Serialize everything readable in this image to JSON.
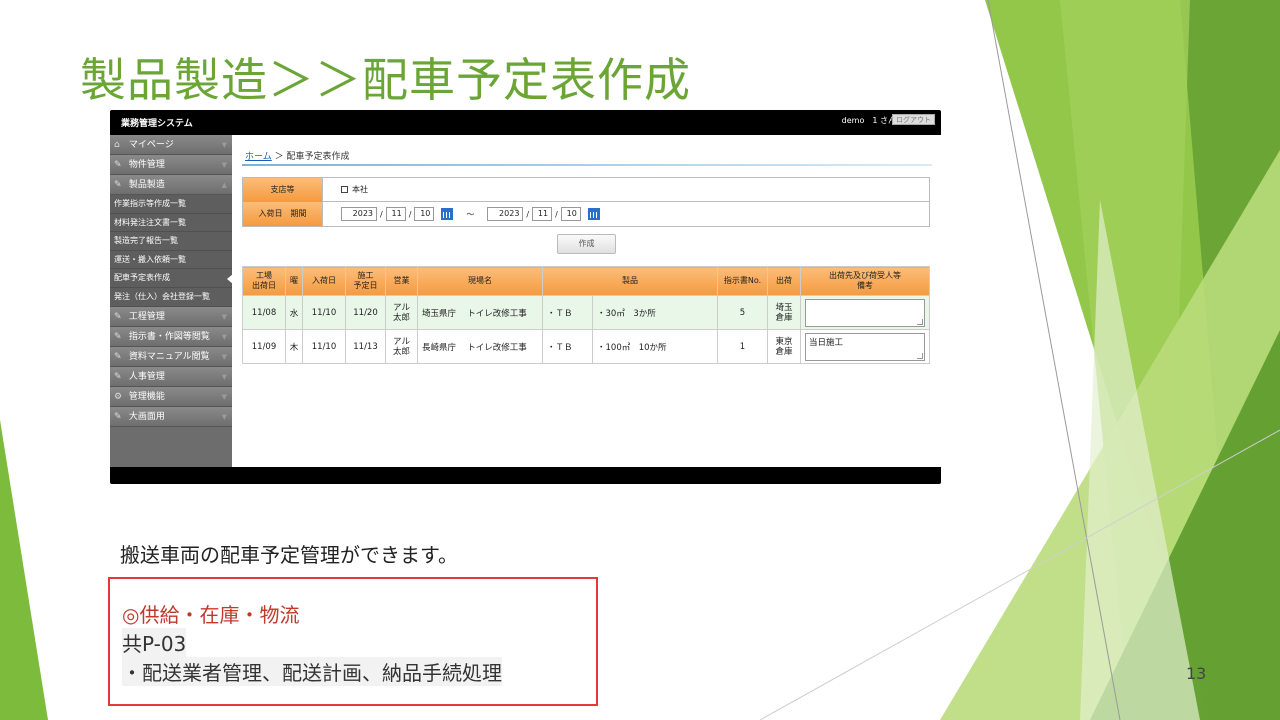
{
  "slide": {
    "title": "製品製造＞＞配車予定表作成",
    "description": "搬送車両の配車予定管理ができます。",
    "page_number": "13",
    "box": {
      "title": "◎供給・在庫・物流",
      "code": "共P-03",
      "item": "・配送業者管理、配送計画、納品手続処理"
    },
    "colors": {
      "title": "#6aa535",
      "box_border": "#e03a3a",
      "box_title": "#c0392b"
    }
  },
  "app": {
    "name": "業務管理システム",
    "user": "demo　1 さん",
    "logout": "ログアウト",
    "sidebar": {
      "items": [
        {
          "icon": "home-icon",
          "label": "マイページ"
        },
        {
          "icon": "pencil-icon",
          "label": "物件管理"
        },
        {
          "icon": "pencil-icon",
          "label": "製品製造"
        }
      ],
      "sub_items": [
        "作業指示等作成一覧",
        "材料発注注文書一覧",
        "製造完了報告一覧",
        "運送・搬入依頼一覧",
        "配車予定表作成",
        "発注（仕入）会社登録一覧"
      ],
      "more_items": [
        {
          "icon": "pencil-icon",
          "label": "工程管理"
        },
        {
          "icon": "pencil-icon",
          "label": "指示書・作図等閲覧"
        },
        {
          "icon": "pencil-icon",
          "label": "資料マニュアル閲覧"
        },
        {
          "icon": "pencil-icon",
          "label": "人事管理"
        },
        {
          "icon": "gear-icon",
          "label": "管理機能"
        },
        {
          "icon": "pencil-icon",
          "label": "大画面用"
        }
      ]
    },
    "breadcrumb": {
      "home": "ホーム",
      "sep": "＞",
      "current": "配車予定表作成"
    },
    "filter": {
      "branch_label": "支店等",
      "branch_option": "本社",
      "period_label": "入荷日　期間",
      "from": {
        "y": "2023",
        "m": "11",
        "d": "10"
      },
      "to": {
        "y": "2023",
        "m": "11",
        "d": "10"
      },
      "slash": "/",
      "tilde": "～"
    },
    "create_button": "作成",
    "table": {
      "headers": [
        "工場\n出荷日",
        "曜",
        "入荷日",
        "施工\n予定日",
        "営業",
        "現場名",
        "製品",
        "指示書No.",
        "出荷",
        "出荷先及び荷受人等\n備考"
      ],
      "rows": [
        {
          "ship": "11/08",
          "dow": "水",
          "arrive": "11/10",
          "work": "11/20",
          "sales": "アル\n太郎",
          "pref": "埼玉県庁",
          "site": "トイレ改修工事",
          "p1": "・ＴＢ",
          "p2": "・30㎡　3か所",
          "no": "5",
          "dest": "埼玉\n倉庫",
          "memo": ""
        },
        {
          "ship": "11/09",
          "dow": "木",
          "arrive": "11/10",
          "work": "11/13",
          "sales": "アル\n太郎",
          "pref": "長崎県庁",
          "site": "トイレ改修工事",
          "p1": "・ＴＢ",
          "p2": "・100㎡　10か所",
          "no": "1",
          "dest": "東京\n倉庫",
          "memo": "当日施工"
        }
      ]
    }
  }
}
